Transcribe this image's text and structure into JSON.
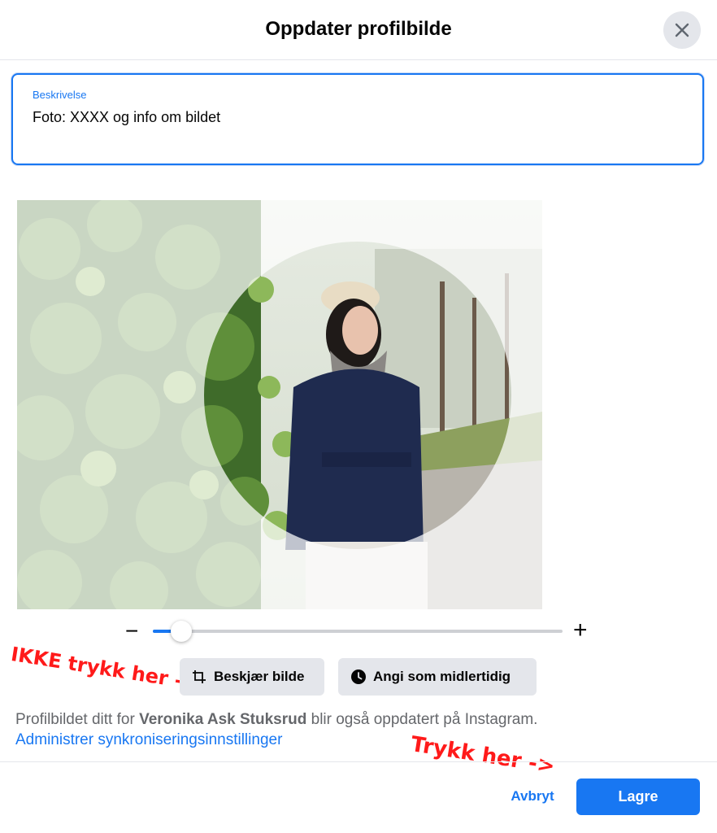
{
  "header": {
    "title": "Oppdater profilbilde",
    "close_icon": "close-icon"
  },
  "description": {
    "label": "Beskrivelse",
    "value": "Foto: XXXX og info om bildet"
  },
  "photo": {
    "subject": "woman-in-beret-and-navy-coat"
  },
  "zoom": {
    "minus_label": "−",
    "plus_label": "+",
    "level": 0.07
  },
  "buttons": {
    "crop_label": "Beskjær bilde",
    "crop_icon": "crop-icon",
    "temporary_label": "Angi som midlertidig",
    "temporary_icon": "clock-icon"
  },
  "annotations": {
    "dont_click": "IKKE trykk her ->",
    "click_here": "Trykk her ->"
  },
  "info": {
    "prefix": "Profilbildet ditt for ",
    "name": "Veronika Ask Stuksrud",
    "suffix": " blir også oppdatert på Instagram.",
    "link": "Administrer synkroniseringsinnstillinger"
  },
  "footer": {
    "cancel_label": "Avbryt",
    "save_label": "Lagre"
  },
  "colors": {
    "accent": "#1877f2",
    "annotation": "#ff1a1a",
    "button_gray": "#e4e6eb"
  }
}
